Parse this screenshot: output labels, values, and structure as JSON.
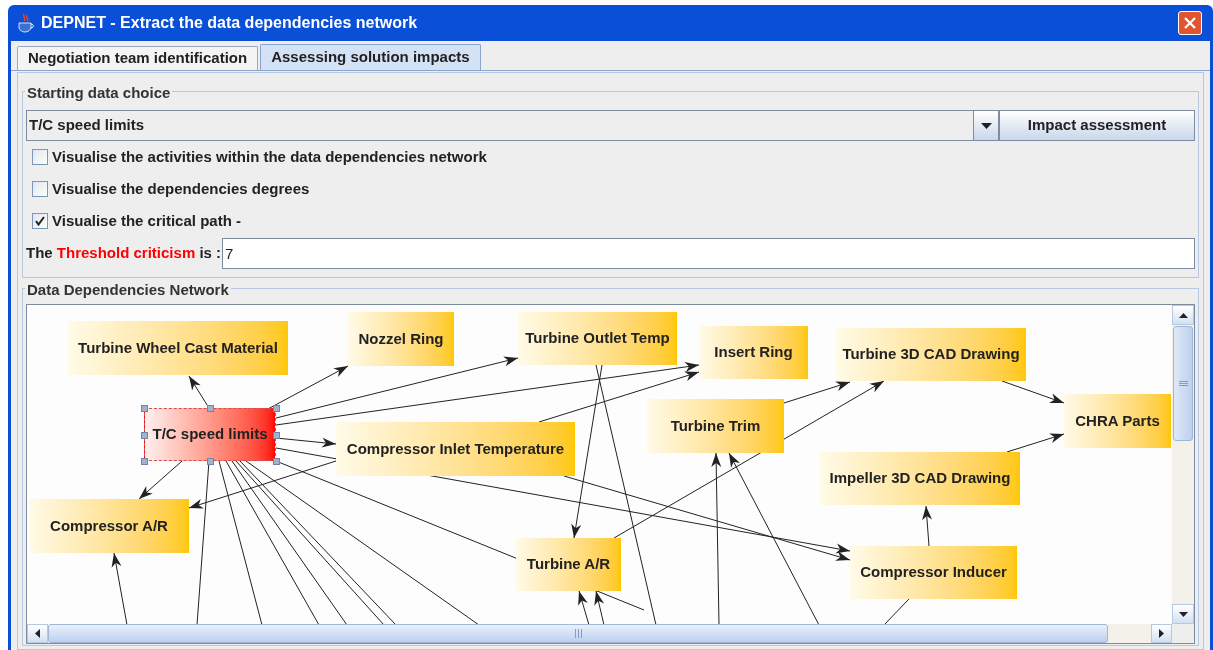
{
  "window": {
    "title": "DEPNET - Extract the data dependencies network"
  },
  "tabs": [
    {
      "label": "Negotiation team identification",
      "selected": false
    },
    {
      "label": "Assessing solution impacts",
      "selected": true
    }
  ],
  "starting_data_choice": {
    "legend": "Starting data choice",
    "dropdown_value": "T/C speed limits",
    "button": "Impact assessment",
    "options": [
      {
        "label": "Visualise the activities within the data dependencies network",
        "checked": false
      },
      {
        "label": "Visualise the dependencies degrees",
        "checked": false
      },
      {
        "label": "Visualise the critical path -",
        "checked": true
      }
    ],
    "threshold": {
      "label_before": "The ",
      "label_highlight": "Threshold criticism",
      "label_after": " is :",
      "value": "7"
    }
  },
  "network": {
    "legend": "Data Dependencies Network",
    "nodes": [
      {
        "label": "Turbine Wheel Cast Material",
        "selected": false
      },
      {
        "label": "Nozzel Ring",
        "selected": false
      },
      {
        "label": "Turbine Outlet Temp",
        "selected": false
      },
      {
        "label": "Insert Ring",
        "selected": false
      },
      {
        "label": "Turbine 3D CAD Drawing",
        "selected": false
      },
      {
        "label": "T/C speed limits",
        "selected": true
      },
      {
        "label": "Compressor Inlet Temperature",
        "selected": false
      },
      {
        "label": "Turbine Trim",
        "selected": false
      },
      {
        "label": "CHRA Parts",
        "selected": false
      },
      {
        "label": "Impeller 3D CAD Drawing",
        "selected": false
      },
      {
        "label": "Compressor A/R",
        "selected": false
      },
      {
        "label": "Turbine A/R",
        "selected": false
      },
      {
        "label": "Compressor Inducer",
        "selected": false
      }
    ]
  }
}
